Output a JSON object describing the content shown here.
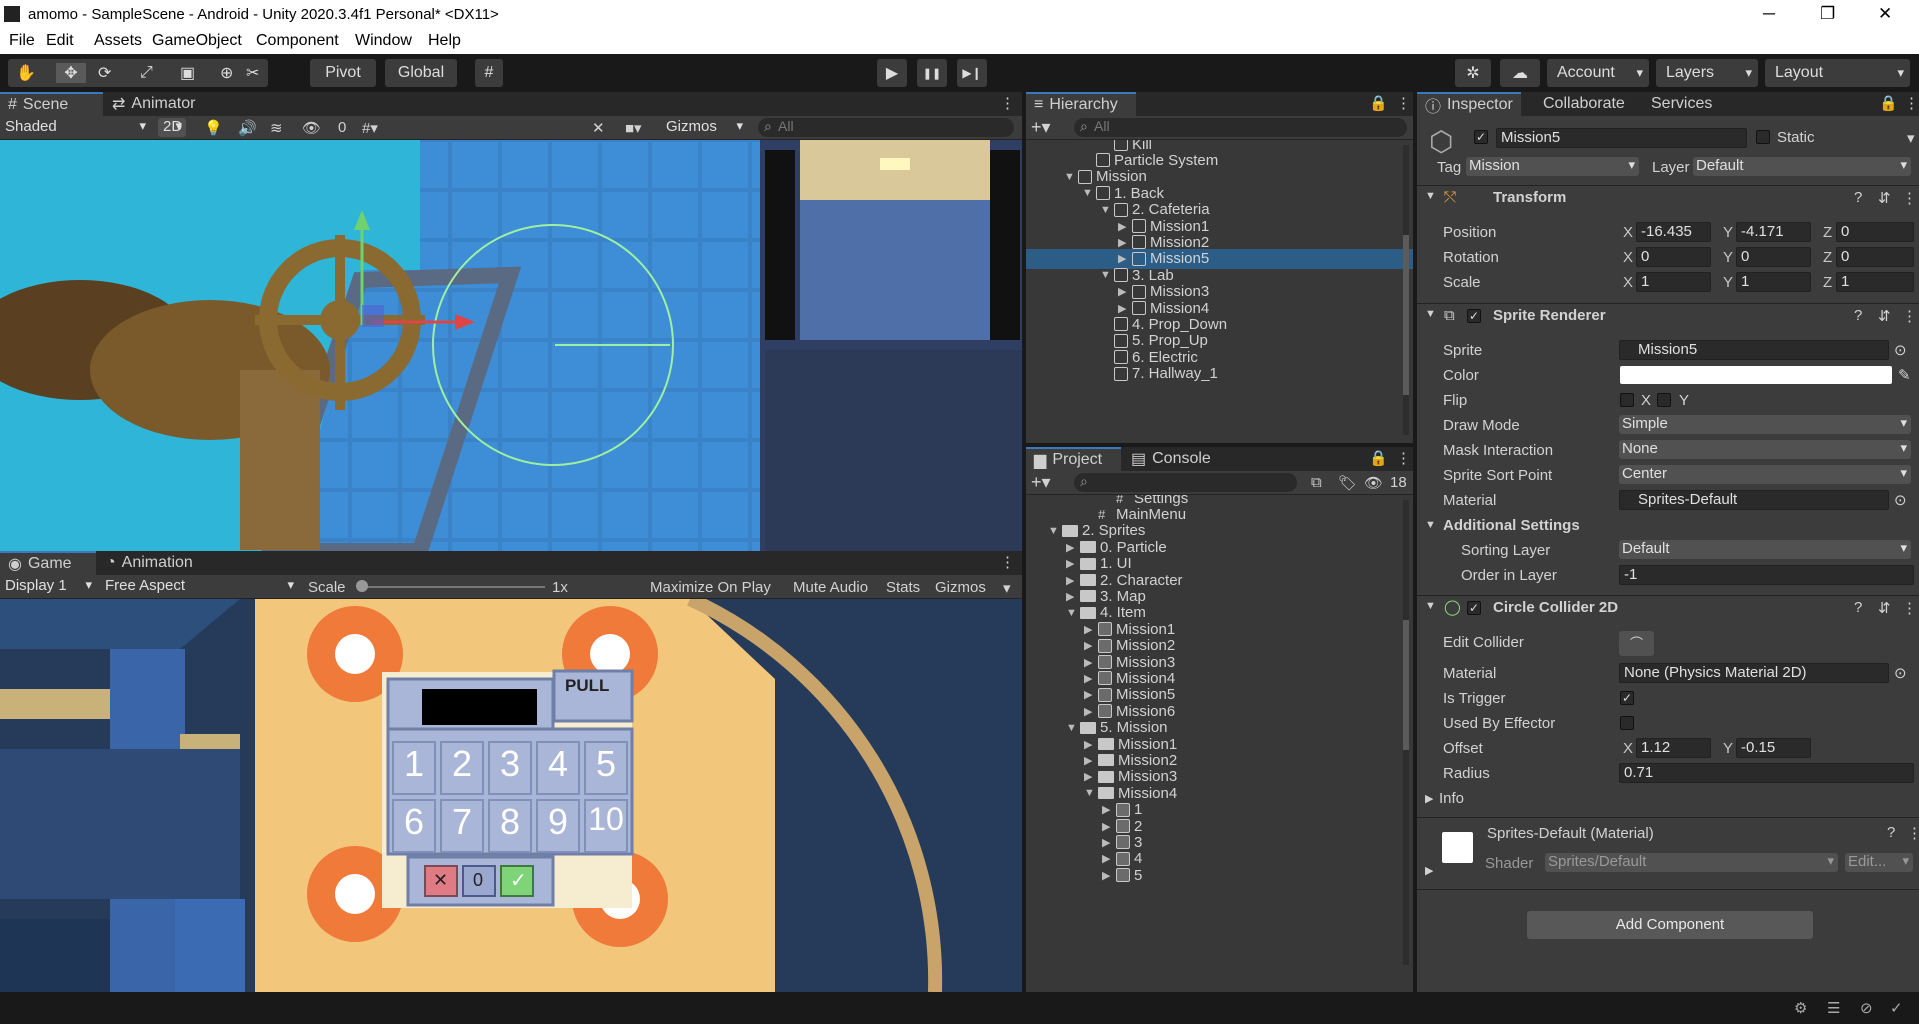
{
  "window": {
    "title": "amomo - SampleScene - Android - Unity 2020.3.4f1 Personal* <DX11>",
    "minimize": "─",
    "maximize": "❐",
    "close": "✕"
  },
  "menu": [
    "File",
    "Edit",
    "Assets",
    "GameObject",
    "Component",
    "Window",
    "Help"
  ],
  "toolbar": {
    "pivot": "Pivot",
    "global": "Global",
    "play": "▶",
    "pause": "❚❚",
    "step": "▶❙",
    "account": "Account",
    "layers": "Layers",
    "layout": "Layout"
  },
  "scene": {
    "tab_scene": "Scene",
    "tab_animator": "Animator",
    "shading": "Shaded",
    "mode_2d": "2D",
    "hidden_count": "0",
    "gizmos": "Gizmos",
    "search_placeholder": "All"
  },
  "game": {
    "tab_game": "Game",
    "tab_animation": "Animation",
    "display": "Display 1",
    "aspect": "Free Aspect",
    "scale_label": "Scale",
    "scale_value": "1x",
    "maximize": "Maximize On Play",
    "mute": "Mute Audio",
    "stats": "Stats",
    "gizmos": "Gizmos"
  },
  "keypad": {
    "pull": "PULL",
    "keys": [
      "1",
      "2",
      "3",
      "4",
      "5",
      "6",
      "7",
      "8",
      "9",
      "10"
    ],
    "cancel": "✕",
    "zero": "0",
    "ok": "✓"
  },
  "hierarchy": {
    "tab": "Hierarchy",
    "search_placeholder": "All",
    "items": [
      {
        "label": "Kill",
        "indent": 4
      },
      {
        "label": "Particle System",
        "indent": 3
      },
      {
        "label": "Mission",
        "indent": 2,
        "arrow": "▼"
      },
      {
        "label": "1. Back",
        "indent": 3,
        "arrow": "▼"
      },
      {
        "label": "2. Cafeteria",
        "indent": 4,
        "arrow": "▼"
      },
      {
        "label": "Mission1",
        "indent": 5,
        "arrow": "▶"
      },
      {
        "label": "Mission2",
        "indent": 5,
        "arrow": "▶"
      },
      {
        "label": "Mission5",
        "indent": 5,
        "arrow": "▶",
        "selected": true
      },
      {
        "label": "3. Lab",
        "indent": 4,
        "arrow": "▼"
      },
      {
        "label": "Mission3",
        "indent": 5,
        "arrow": "▶"
      },
      {
        "label": "Mission4",
        "indent": 5,
        "arrow": "▶"
      },
      {
        "label": "4. Prop_Down",
        "indent": 4
      },
      {
        "label": "5. Prop_Up",
        "indent": 4
      },
      {
        "label": "6. Electric",
        "indent": 4
      },
      {
        "label": "7. Hallway_1",
        "indent": 4
      }
    ]
  },
  "project": {
    "tab_project": "Project",
    "tab_console": "Console",
    "hidden_count": "18",
    "items": [
      {
        "label": "Settings",
        "indent": 4,
        "type": "script"
      },
      {
        "label": "MainMenu",
        "indent": 3,
        "type": "script"
      },
      {
        "label": "2. Sprites",
        "indent": 1,
        "arrow": "▼",
        "type": "folder"
      },
      {
        "label": "0. Particle",
        "indent": 2,
        "arrow": "▶",
        "type": "folder"
      },
      {
        "label": "1. UI",
        "indent": 2,
        "arrow": "▶",
        "type": "folder"
      },
      {
        "label": "2. Character",
        "indent": 2,
        "arrow": "▶",
        "type": "folder"
      },
      {
        "label": "3. Map",
        "indent": 2,
        "arrow": "▶",
        "type": "folder"
      },
      {
        "label": "4. Item",
        "indent": 2,
        "arrow": "▼",
        "type": "folder"
      },
      {
        "label": "Mission1",
        "indent": 3,
        "arrow": "▶",
        "type": "sprite"
      },
      {
        "label": "Mission2",
        "indent": 3,
        "arrow": "▶",
        "type": "sprite"
      },
      {
        "label": "Mission3",
        "indent": 3,
        "arrow": "▶",
        "type": "sprite"
      },
      {
        "label": "Mission4",
        "indent": 3,
        "arrow": "▶",
        "type": "sprite"
      },
      {
        "label": "Mission5",
        "indent": 3,
        "arrow": "▶",
        "type": "sprite"
      },
      {
        "label": "Mission6",
        "indent": 3,
        "arrow": "▶",
        "type": "sprite"
      },
      {
        "label": "5. Mission",
        "indent": 2,
        "arrow": "▼",
        "type": "folder"
      },
      {
        "label": "Mission1",
        "indent": 3,
        "arrow": "▶",
        "type": "folder"
      },
      {
        "label": "Mission2",
        "indent": 3,
        "arrow": "▶",
        "type": "folder"
      },
      {
        "label": "Mission3",
        "indent": 3,
        "arrow": "▶",
        "type": "folder"
      },
      {
        "label": "Mission4",
        "indent": 3,
        "arrow": "▼",
        "type": "folder"
      },
      {
        "label": "1",
        "indent": 4,
        "arrow": "▶",
        "type": "sprite"
      },
      {
        "label": "2",
        "indent": 4,
        "arrow": "▶",
        "type": "sprite"
      },
      {
        "label": "3",
        "indent": 4,
        "arrow": "▶",
        "type": "sprite"
      },
      {
        "label": "4",
        "indent": 4,
        "arrow": "▶",
        "type": "sprite"
      },
      {
        "label": "5",
        "indent": 4,
        "arrow": "▶",
        "type": "sprite"
      }
    ]
  },
  "inspector": {
    "tab_inspector": "Inspector",
    "tab_collaborate": "Collaborate",
    "tab_services": "Services",
    "object_name": "Mission5",
    "static": "Static",
    "tag_label": "Tag",
    "tag_value": "Mission",
    "layer_label": "Layer",
    "layer_value": "Default",
    "transform": {
      "title": "Transform",
      "position_label": "Position",
      "rotation_label": "Rotation",
      "scale_label": "Scale",
      "position": [
        "-16.435",
        "-4.171",
        "0"
      ],
      "rotation": [
        "0",
        "0",
        "0"
      ],
      "scale": [
        "1",
        "1",
        "1"
      ]
    },
    "sprite_renderer": {
      "title": "Sprite Renderer",
      "sprite_label": "Sprite",
      "sprite_value": "Mission5",
      "color_label": "Color",
      "flip_label": "Flip",
      "flip_x": "X",
      "flip_y": "Y",
      "draw_mode_label": "Draw Mode",
      "draw_mode": "Simple",
      "mask_label": "Mask Interaction",
      "mask": "None",
      "sort_point_label": "Sprite Sort Point",
      "sort_point": "Center",
      "material_label": "Material",
      "material": "Sprites-Default",
      "additional": "Additional Settings",
      "sorting_layer_label": "Sorting Layer",
      "sorting_layer": "Default",
      "order_label": "Order in Layer",
      "order": "-1"
    },
    "circle_collider": {
      "title": "Circle Collider 2D",
      "edit_label": "Edit Collider",
      "material_label": "Material",
      "material": "None (Physics Material 2D)",
      "trigger_label": "Is Trigger",
      "effector_label": "Used By Effector",
      "offset_label": "Offset",
      "offset_x": "1.12",
      "offset_y": "-0.15",
      "radius_label": "Radius",
      "radius": "0.71",
      "info_label": "Info"
    },
    "material_section": {
      "title": "Sprites-Default (Material)",
      "shader_label": "Shader",
      "shader": "Sprites/Default",
      "edit": "Edit..."
    },
    "add_component": "Add Component"
  }
}
